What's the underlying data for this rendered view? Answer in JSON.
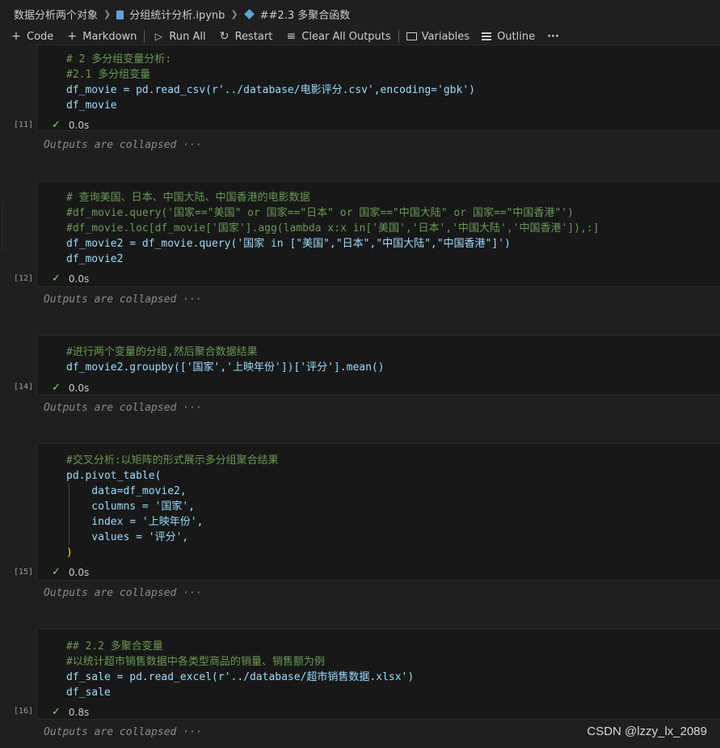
{
  "breadcrumb": {
    "folder": "数据分析两个对象",
    "file": "分组统计分析.ipynb",
    "section": "##2.3 多聚合函数"
  },
  "toolbar": {
    "code_label": "Code",
    "markdown_label": "Markdown",
    "run_all_label": "Run All",
    "restart_label": "Restart",
    "clear_label": "Clear All Outputs",
    "variables_label": "Variables",
    "outline_label": "Outline",
    "more_label": "···"
  },
  "cells": [
    {
      "exec_count": "[11]",
      "time": "0.0s",
      "lines": [
        "# 2 多分组变量分析:",
        "#2.1 多分组变量",
        "df_movie = pd.read_csv(r'../database/电影评分.csv',encoding='gbk')",
        "df_movie"
      ]
    },
    {
      "exec_count": "[12]",
      "time": "0.0s",
      "lines": [
        "# 查询美国、日本、中国大陆、中国香港的电影数据",
        "#df_movie.query('国家==\"美国\" or 国家==\"日本\" or 国家==\"中国大陆\" or 国家==\"中国香港\"')",
        "#df_movie.loc[df_movie['国家'].agg(lambda x:x in['美国','日本','中国大陆','中国香港']),:]",
        "df_movie2 = df_movie.query('国家 in [\"美国\",\"日本\",\"中国大陆\",\"中国香港\"]')",
        "df_movie2"
      ]
    },
    {
      "exec_count": "[14]",
      "time": "0.0s",
      "lines": [
        "#进行两个变量的分组,然后聚合数据结果",
        "df_movie2.groupby(['国家','上映年份'])['评分'].mean()"
      ]
    },
    {
      "exec_count": "[15]",
      "time": "0.0s",
      "lines": [
        "#交叉分析:以矩阵的形式展示多分组聚合结果",
        "pd.pivot_table(",
        "    data=df_movie2,",
        "    columns = '国家',",
        "    index = '上映年份',",
        "    values = '评分',",
        ")"
      ]
    },
    {
      "exec_count": "[16]",
      "time": "0.8s",
      "lines": [
        "## 2.2 多聚合变量",
        "#以统计超市销售数据中各类型商品的销量、销售额为例",
        "df_sale = pd.read_excel(r'../database/超市销售数据.xlsx')",
        "df_sale"
      ]
    }
  ],
  "collapsed_label": "Outputs are collapsed ···",
  "watermark": "CSDN @lzzy_lx_2089",
  "colors": {
    "background": "#1f1f1f",
    "cell_bg": "#181818",
    "comment": "#6a9955",
    "string": "#ce9178",
    "variable": "#9cdcfe",
    "function": "#dcdcaa",
    "check": "#89d185"
  }
}
